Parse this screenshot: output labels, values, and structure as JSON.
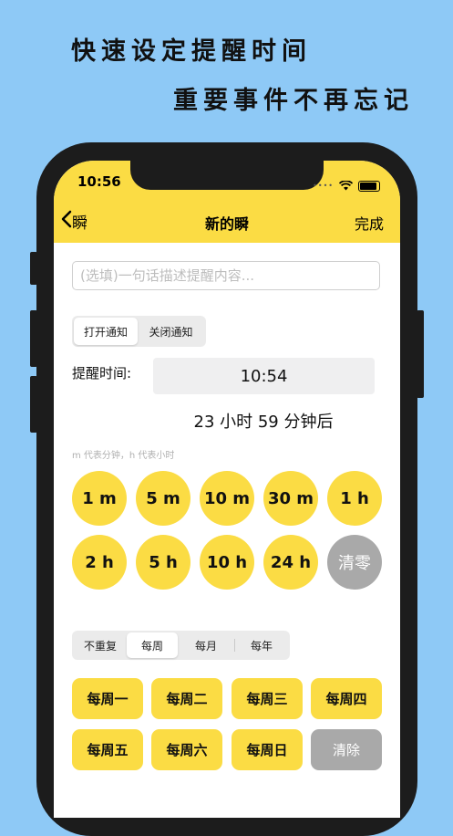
{
  "promo": {
    "line1": "快速设定提醒时间",
    "line2": "重要事件不再忘记"
  },
  "status_bar": {
    "time": "10:56"
  },
  "nav": {
    "back_label": "瞬",
    "title": "新的瞬",
    "done_label": "完成"
  },
  "description": {
    "placeholder": "(选填)一句话描述提醒内容...",
    "value": ""
  },
  "notification_toggle": {
    "options": [
      "打开通知",
      "关闭通知"
    ],
    "selected": "打开通知"
  },
  "reminder": {
    "label": "提醒时间:",
    "time": "10:54",
    "countdown": "23 小时 59 分钟后"
  },
  "hint": "m 代表分钟，h 代表小时",
  "quick_times": [
    "1 m",
    "5 m",
    "10 m",
    "30 m",
    "1 h",
    "2 h",
    "5 h",
    "10 h",
    "24 h"
  ],
  "clear_time_label": "清零",
  "repeat": {
    "options": [
      "不重复",
      "每周",
      "每月",
      "每年"
    ],
    "selected": "每周"
  },
  "weekdays": [
    "每周一",
    "每周二",
    "每周三",
    "每周四",
    "每周五",
    "每周六",
    "每周日"
  ],
  "clear_days_label": "清除",
  "colors": {
    "accent": "#fbdc44",
    "background": "#8ec9f6",
    "phone_frame": "#1c1c1c",
    "clear_button": "#a9a9a9"
  }
}
